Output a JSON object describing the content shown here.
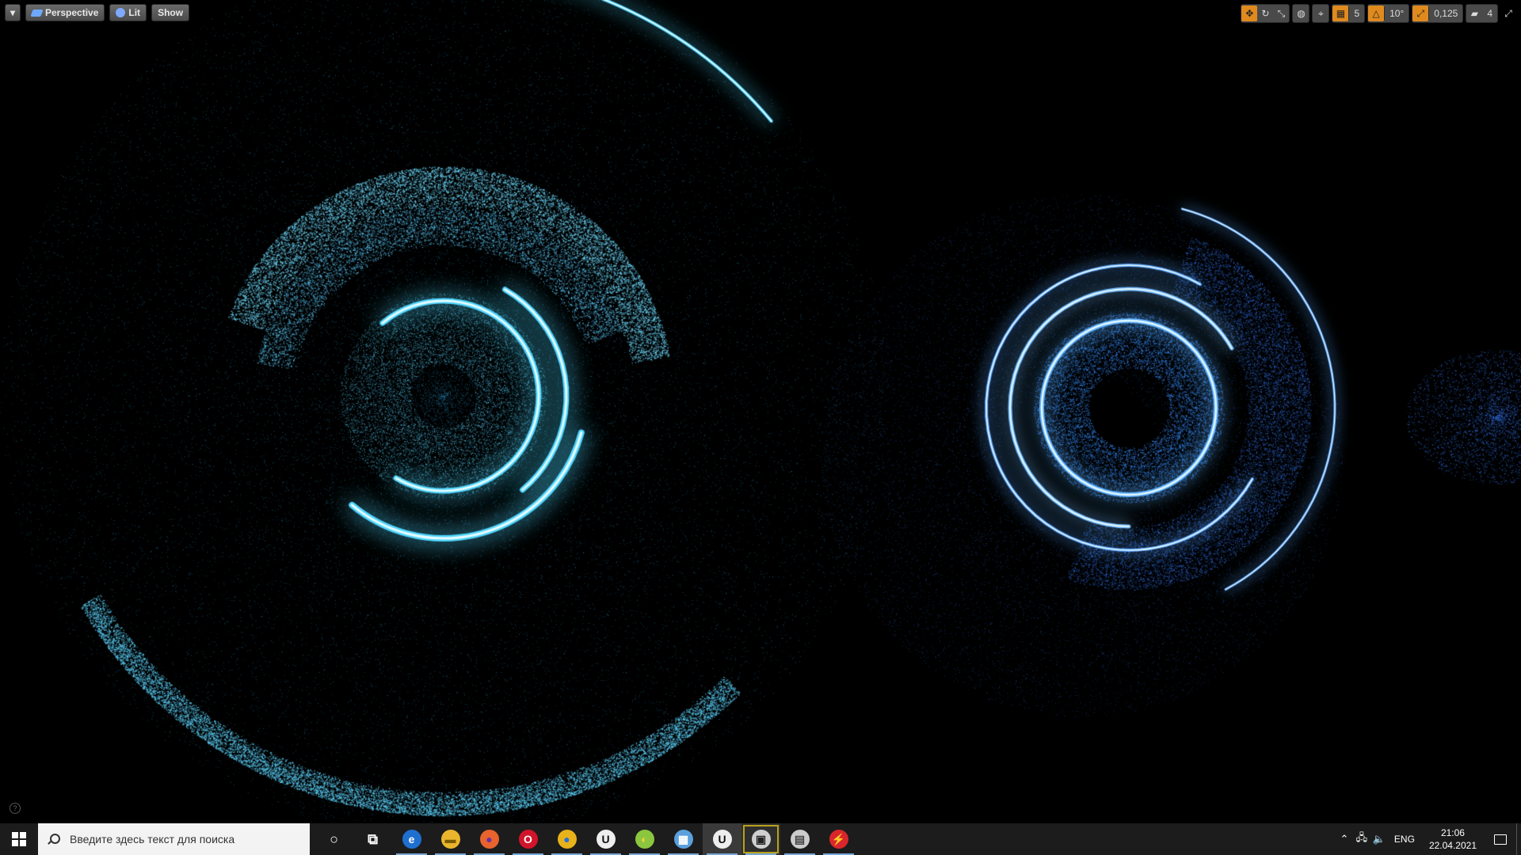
{
  "viewport_toolbar": {
    "perspective_label": "Perspective",
    "lit_label": "Lit",
    "show_label": "Show"
  },
  "viewport_right": {
    "grid_snap_value": "5",
    "rotation_snap_value": "10°",
    "scale_snap_value": "0,125",
    "camera_speed_value": "4"
  },
  "taskbar": {
    "search_placeholder": "Введите здесь текст для поиска",
    "apps": [
      {
        "name": "cortana-icon",
        "glyph": "○",
        "color": "#1c1c1c",
        "text": "#fff"
      },
      {
        "name": "task-view-icon",
        "glyph": "⧉",
        "color": "#1c1c1c",
        "text": "#fff"
      },
      {
        "name": "edge-icon",
        "glyph": "e",
        "color": "#1f6fd1",
        "text": "#fff"
      },
      {
        "name": "file-explorer-icon",
        "glyph": "▬",
        "color": "#e9b52c",
        "text": "#7a5a00"
      },
      {
        "name": "firefox-icon",
        "glyph": "●",
        "color": "#e8632d",
        "text": "#6b2ea3"
      },
      {
        "name": "opera-icon",
        "glyph": "O",
        "color": "#d2142a",
        "text": "#fff"
      },
      {
        "name": "chrome-icon",
        "glyph": "●",
        "color": "#e8b21b",
        "text": "#2a6fd6"
      },
      {
        "name": "unreal-engine-icon",
        "glyph": "U",
        "color": "#eeeeee",
        "text": "#111"
      },
      {
        "name": "app-icon",
        "glyph": "◐",
        "color": "#8cc63f",
        "text": "#f4d03f"
      },
      {
        "name": "calculator-icon",
        "glyph": "▦",
        "color": "#5aa0dc",
        "text": "#fff"
      },
      {
        "name": "unreal-editor-icon",
        "glyph": "U",
        "color": "#eeeeee",
        "text": "#111"
      },
      {
        "name": "film-app-icon",
        "glyph": "▣",
        "color": "#cfcfcf",
        "text": "#222"
      },
      {
        "name": "printer-icon",
        "glyph": "▤",
        "color": "#cccccc",
        "text": "#444"
      },
      {
        "name": "flash-app-icon",
        "glyph": "⚡",
        "color": "#d9262c",
        "text": "#fff"
      }
    ],
    "tray": {
      "language": "ENG",
      "time": "21:06",
      "date": "22.04.2021"
    }
  },
  "colors": {
    "glow_cyan": "#4fd6ff",
    "glow_blue": "#3a8cff",
    "taskbar_bg": "#1c1c1c"
  }
}
